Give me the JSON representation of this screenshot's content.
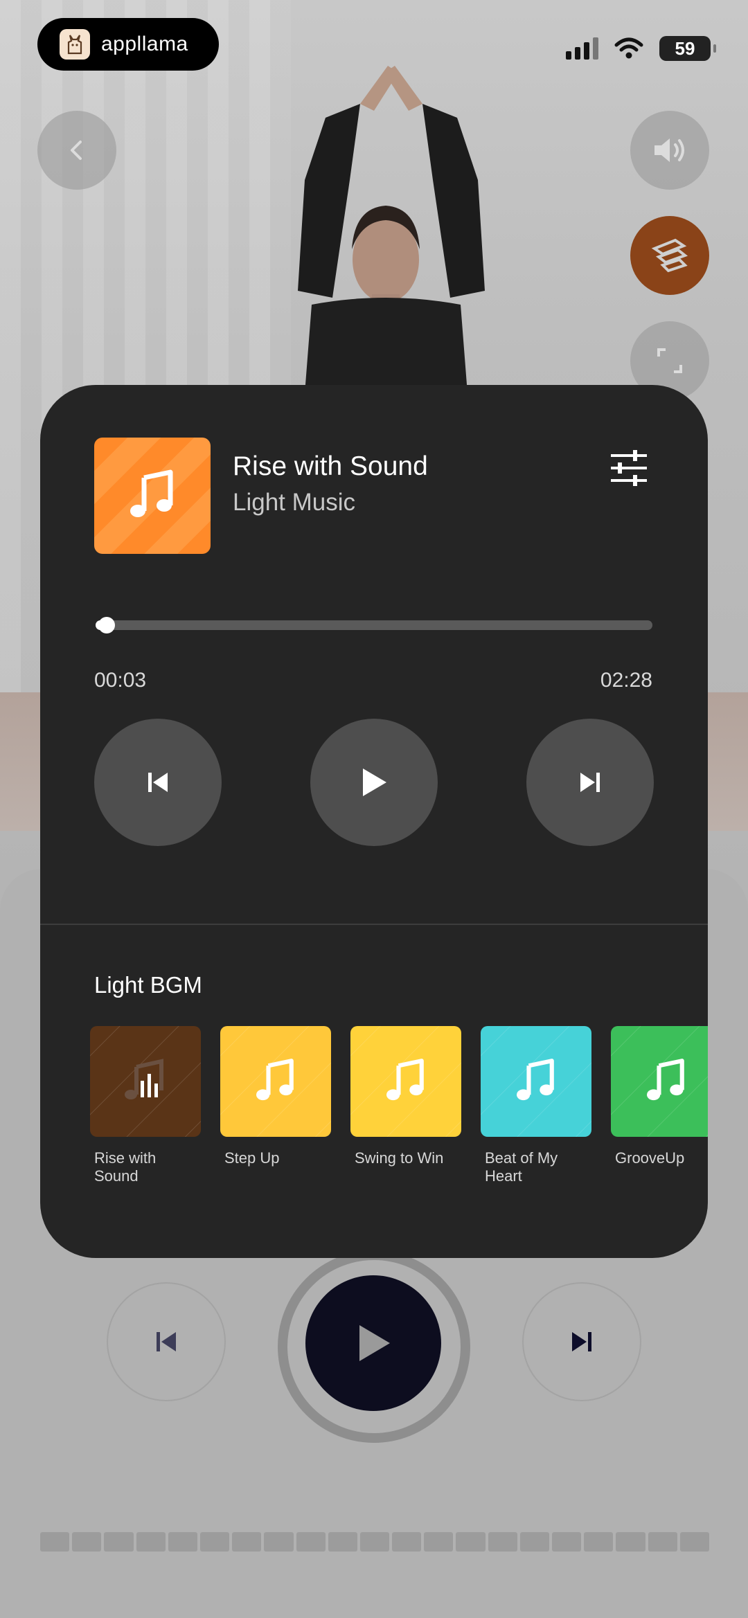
{
  "status_bar": {
    "brand_name": "appllama",
    "battery": "59"
  },
  "player": {
    "track_title": "Rise with Sound",
    "track_subtitle": "Light Music",
    "current_time": "00:03",
    "total_time": "02:28",
    "progress_fraction": 0.02
  },
  "playlist": {
    "title": "Light BGM",
    "items": [
      {
        "label": "Rise with Sound",
        "color": "#5a3417",
        "playing": true
      },
      {
        "label": "Step Up",
        "color": "#ffc83a",
        "playing": false
      },
      {
        "label": "Swing to Win",
        "color": "#ffd23a",
        "playing": false
      },
      {
        "label": "Beat of My Heart",
        "color": "#46d2d8",
        "playing": false
      },
      {
        "label": "GrooveUp",
        "color": "#3cbf5a",
        "playing": false
      }
    ]
  },
  "icons": {
    "back": "chevron-left-icon",
    "volume": "speaker-icon",
    "music": "music-settings-icon",
    "fullscreen": "expand-icon",
    "equalizer": "sliders-icon"
  },
  "colors": {
    "accent_orange": "#ff8a2a",
    "card_bg": "#252525",
    "main_play": "#0d0d1f"
  }
}
